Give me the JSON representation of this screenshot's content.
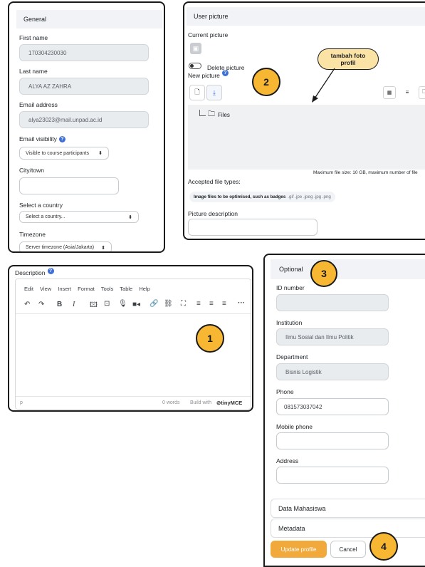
{
  "general": {
    "header": "General",
    "first_name": {
      "label": "First name",
      "value": "170304230030"
    },
    "last_name": {
      "label": "Last name",
      "value": "ALYA AZ ZAHRA"
    },
    "email": {
      "label": "Email address",
      "value": "alya23023@mail.unpad.ac.id"
    },
    "email_visibility": {
      "label": "Email visibility",
      "value": "Visible to course participants"
    },
    "city": {
      "label": "City/town",
      "value": ""
    },
    "country": {
      "label": "Select a country",
      "value": "Select a country..."
    },
    "timezone": {
      "label": "Timezone",
      "value": "Server timezone (Asia/Jakarta)"
    }
  },
  "user_picture": {
    "header": "User picture",
    "current_label": "Current picture",
    "delete_label": "Delete picture",
    "new_label": "New picture",
    "files_label": "Files",
    "max_size": "Maximum file size: 10 GB, maximum number of file",
    "accepted_label": "Accepted file types:",
    "accepted_strong": "Image files to be optimised, such as badges",
    "accepted_ext": ".gif .jpe .jpeg .jpg .png",
    "picture_description_label": "Picture description",
    "callout": "tambah foto profil"
  },
  "description": {
    "label": "Description",
    "menu": [
      "Edit",
      "View",
      "Insert",
      "Format",
      "Tools",
      "Table",
      "Help"
    ],
    "status_path": "p",
    "word_count": "0 words",
    "build_with": "Build with",
    "brand": "tinyMCE"
  },
  "optional": {
    "header": "Optional",
    "id_number": {
      "label": "ID number",
      "value": ""
    },
    "institution": {
      "label": "Institution",
      "value": "Ilmu Sosial dan Ilmu Politik"
    },
    "department": {
      "label": "Department",
      "value": "Bisnis Logistik"
    },
    "phone": {
      "label": "Phone",
      "value": "081573037042"
    },
    "mobile": {
      "label": "Mobile phone",
      "value": ""
    },
    "address": {
      "label": "Address",
      "value": ""
    },
    "data_mahasiswa": "Data Mahasiswa",
    "metadata": "Metadata",
    "update_button": "Update profile",
    "cancel_button": "Cancel"
  },
  "badges": [
    "1",
    "2",
    "3",
    "4"
  ],
  "colors": {
    "accent": "#f7b733",
    "primary": "#f0a93a",
    "help": "#3d6fd6",
    "callout_bg": "#fbe3a6"
  }
}
